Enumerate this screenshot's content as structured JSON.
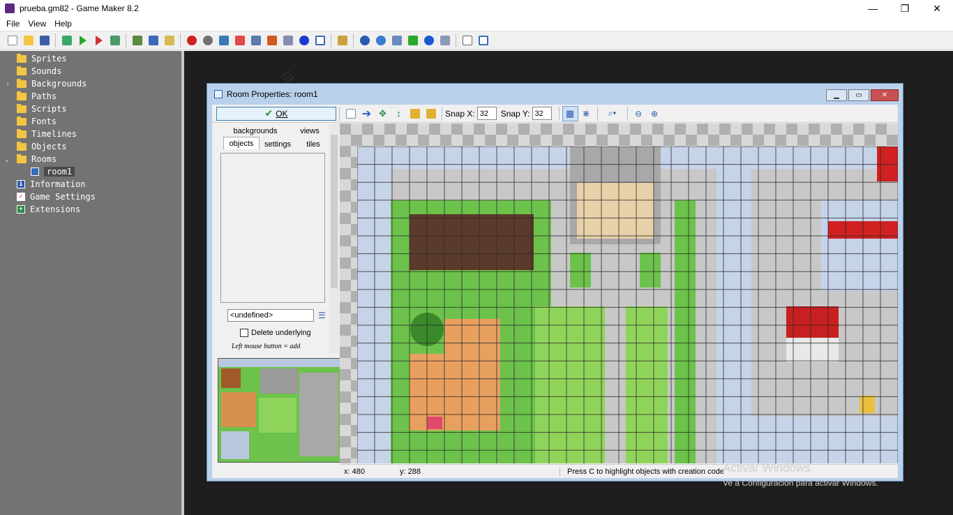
{
  "window": {
    "title": "prueba.gm82 - Game Maker 8.2",
    "minimize": "—",
    "maximize": "❐",
    "close": "✕"
  },
  "menu": [
    "File",
    "View",
    "Help"
  ],
  "tree": {
    "items": [
      "Sprites",
      "Sounds",
      "Backgrounds",
      "Paths",
      "Scripts",
      "Fonts",
      "Timelines",
      "Objects",
      "Rooms"
    ],
    "room_child": "room1",
    "extras": [
      "Information",
      "Game Settings",
      "Extensions"
    ]
  },
  "dialog": {
    "title": "Room Properties: room1",
    "ok_label": "OK",
    "snap_x_label": "Snap X:",
    "snap_x_value": "32",
    "snap_y_label": "Snap Y:",
    "snap_y_value": "32",
    "tabs": {
      "backgrounds": "backgrounds",
      "views": "views",
      "objects": "objects",
      "settings": "settings",
      "tiles": "tiles"
    },
    "object_select": "<undefined>",
    "delete_underlying": "Delete underlying",
    "hint": "Left mouse button = add",
    "status": {
      "x": "x: 480",
      "y": "y: 288",
      "message": "Press C to highlight objects with creation code"
    }
  },
  "watermark": {
    "line1": "Activar Windows",
    "line2": "Ve a Configuración para activar Windows."
  },
  "colors": {
    "sidebar": "#737373",
    "workspace": "#1e1e1e",
    "dialog_frame": "#b9d1ea",
    "grass": "#6cc24a",
    "wall": "#c6d4ea",
    "floor": "#c8c8c8"
  }
}
